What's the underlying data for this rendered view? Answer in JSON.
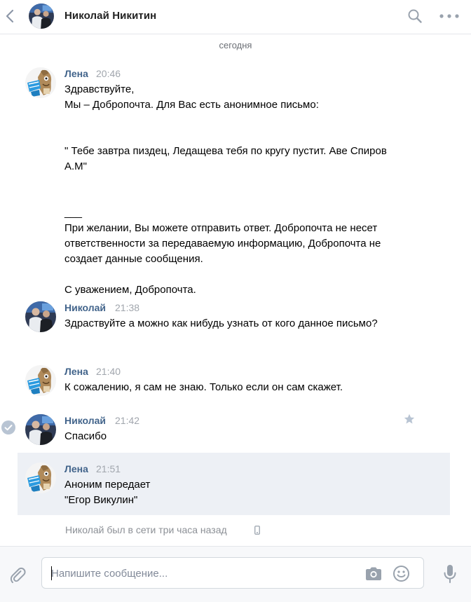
{
  "header": {
    "title": "Николай Никитин"
  },
  "date_separator": "сегодня",
  "messages": [
    {
      "author": "Лена",
      "time": "20:46",
      "avatar": "lena",
      "text": "Здравствуйте,\nМы – Добропочта. Для Вас есть анонимное письмо:\n\n\n\" Тебе завтра пиздец, Ледащева тебя по кругу пустит. Аве Спиров А.М\"\n\n\n___\nПри желании, Вы можете отправить ответ. Добропочта не несет ответственности за передаваемую информацию, Добропочта не создает данные сообщения.\n\nС уважением, Добропочта."
    },
    {
      "author": "Николай",
      "time": "21:38",
      "avatar": "nikolai",
      "text": "Здраствуйте а можно как нибудь узнать от кого данное письмо?"
    },
    {
      "author": "Лена",
      "time": "21:40",
      "avatar": "lena",
      "text": "К сожалению, я сам не знаю. Только если он сам скажет."
    },
    {
      "author": "Николай",
      "time": "21:42",
      "avatar": "nikolai",
      "text": "Спасибо",
      "selected": true
    },
    {
      "author": "Лена",
      "time": "21:51",
      "avatar": "lena",
      "text": "Аноним передает\n\"Егор Викулин\"",
      "highlighted": true
    }
  ],
  "status": {
    "text": "Николай был в сети три часа назад",
    "device_icon": "phone-icon"
  },
  "composer": {
    "placeholder": "Напишите сообщение...",
    "value": ""
  },
  "icons": {
    "back": "chevron-left-icon",
    "search": "search-icon",
    "more": "more-icon",
    "attach": "paperclip-icon",
    "camera": "camera-icon",
    "smile": "smile-icon",
    "mic": "microphone-icon",
    "star": "star-icon",
    "check": "check-icon"
  },
  "colors": {
    "author": "#42648b",
    "time": "#a1a6ad",
    "highlight_bg": "#edf0f5",
    "icon": "#99a2ad",
    "check_bg": "#b8c4d3"
  }
}
